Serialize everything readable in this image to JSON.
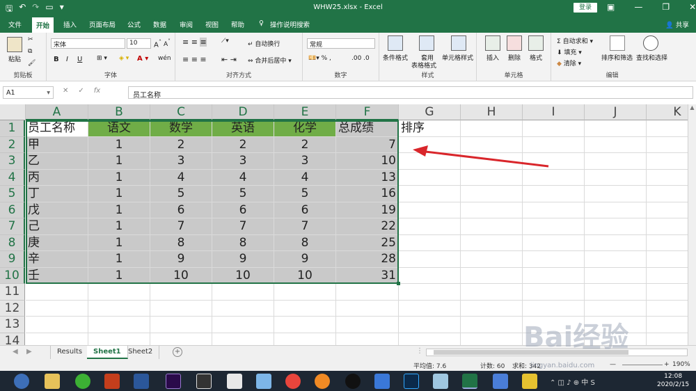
{
  "window": {
    "title": "WHW25.xlsx  -  Excel",
    "login": "登录",
    "share": "共享"
  },
  "tabs": [
    "文件",
    "开始",
    "插入",
    "页面布局",
    "公式",
    "数据",
    "审阅",
    "视图",
    "帮助",
    "操作说明搜索"
  ],
  "ribbon": {
    "clipboard": {
      "paste": "粘贴",
      "label": "剪贴板"
    },
    "font": {
      "name": "宋体",
      "size": "10",
      "bold": "B",
      "italic": "I",
      "underline": "U",
      "wen": "wén",
      "label": "字体"
    },
    "alignment": {
      "wrap": "自动换行",
      "merge": "合并后居中",
      "label": "对齐方式"
    },
    "number": {
      "format": "常规",
      "label": "数字"
    },
    "styles": {
      "cond": "条件格式",
      "table1": "套用",
      "table2": "表格格式",
      "cell": "单元格样式",
      "label": "样式"
    },
    "cells": {
      "insert": "插入",
      "delete": "删除",
      "format": "格式",
      "label": "单元格"
    },
    "editing": {
      "autosum": "自动求和",
      "fill": "填充",
      "clear": "清除",
      "sort": "排序和筛选",
      "find": "查找和选择",
      "label": "编辑"
    }
  },
  "formula": {
    "namebox": "A1",
    "fx": "fx",
    "content": "员工名称"
  },
  "columns": [
    "A",
    "B",
    "C",
    "D",
    "E",
    "F",
    "G",
    "H",
    "I",
    "J",
    "K"
  ],
  "rows": [
    "1",
    "2",
    "3",
    "4",
    "5",
    "6",
    "7",
    "8",
    "9",
    "10",
    "11",
    "12",
    "13",
    "14"
  ],
  "header_row": [
    "员工名称",
    "语文",
    "数学",
    "英语",
    "化学",
    "总成绩",
    "排序"
  ],
  "data_rows": [
    [
      "甲",
      "1",
      "2",
      "2",
      "2",
      "7"
    ],
    [
      "乙",
      "1",
      "3",
      "3",
      "3",
      "10"
    ],
    [
      "丙",
      "1",
      "4",
      "4",
      "4",
      "13"
    ],
    [
      "丁",
      "1",
      "5",
      "5",
      "5",
      "16"
    ],
    [
      "戊",
      "1",
      "6",
      "6",
      "6",
      "19"
    ],
    [
      "己",
      "1",
      "7",
      "7",
      "7",
      "22"
    ],
    [
      "庚",
      "1",
      "8",
      "8",
      "8",
      "25"
    ],
    [
      "辛",
      "1",
      "9",
      "9",
      "9",
      "28"
    ],
    [
      "壬",
      "1",
      "10",
      "10",
      "10",
      "31"
    ]
  ],
  "sheets": [
    "Results",
    "Sheet1",
    "Sheet2"
  ],
  "status": {
    "average": "平均值: 7.6",
    "count": "计数: 60",
    "sum": "求和: 342",
    "zoom": "190%"
  },
  "clock": {
    "time": "12:08",
    "date": "2020/2/15"
  },
  "watermark": {
    "brand": "Bai经验",
    "url": "jingyan.baidu.com"
  },
  "colors": {
    "excel_green": "#217346",
    "header_green": "#70ad47",
    "selection_gray": "#c9c9c9",
    "arrow": "#d9262b"
  }
}
